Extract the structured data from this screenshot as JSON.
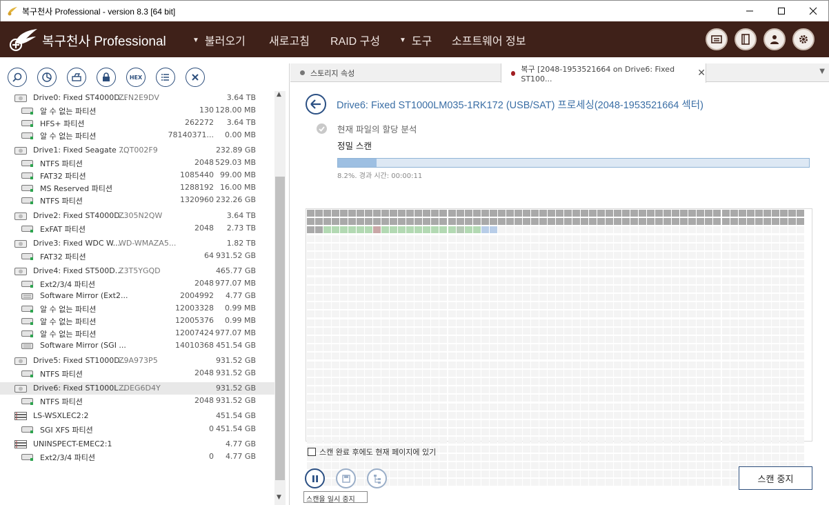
{
  "window": {
    "title": "복구천사 Professional - version 8.3 [64 bit]"
  },
  "header": {
    "brand": "복구천사 Professional",
    "menu": [
      {
        "label": "불러오기",
        "has_caret": true
      },
      {
        "label": "새로고침",
        "has_caret": false
      },
      {
        "label": "RAID 구성",
        "has_caret": false
      },
      {
        "label": "도구",
        "has_caret": true
      },
      {
        "label": "소프트웨어 정보",
        "has_caret": false
      }
    ],
    "icons": [
      "messages-icon",
      "panel-icon",
      "user-icon",
      "settings-icon"
    ]
  },
  "left_toolbar": {
    "icons": [
      "search-icon",
      "scan-icon",
      "open-drive-icon",
      "lock-icon",
      "hex-icon",
      "list-icon",
      "close-icon"
    ],
    "hex_label": "HEX"
  },
  "tree": [
    {
      "type": "drive",
      "name": "Drive0: Fixed ST4000D...",
      "serial": "ZFN2E9DV",
      "start": "",
      "size": "3.64 TB",
      "icon": "hdd-icon"
    },
    {
      "type": "part",
      "name": "알 수 없는 파티션",
      "start": "130",
      "size": "128.00 MB",
      "icon": "partition-icon"
    },
    {
      "type": "part",
      "name": "HFS+ 파티션",
      "start": "262272",
      "size": "3.64 TB",
      "icon": "partition-icon"
    },
    {
      "type": "part",
      "name": "알 수 없는 파티션",
      "start": "78140371...",
      "size": "0.00 MB",
      "icon": "partition-icon"
    },
    {
      "type": "drive",
      "name": "Drive1: Fixed Seagate ...",
      "serial": "7QT002F9",
      "start": "",
      "size": "232.89 GB",
      "icon": "hdd-icon"
    },
    {
      "type": "part",
      "name": "NTFS 파티션",
      "start": "2048",
      "size": "529.03 MB",
      "icon": "partition-icon"
    },
    {
      "type": "part",
      "name": "FAT32 파티션",
      "start": "1085440",
      "size": "99.00 MB",
      "icon": "partition-icon"
    },
    {
      "type": "part",
      "name": "MS Reserved 파티션",
      "start": "1288192",
      "size": "16.00 MB",
      "icon": "partition-icon"
    },
    {
      "type": "part",
      "name": "NTFS 파티션",
      "start": "1320960",
      "size": "232.26 GB",
      "icon": "partition-icon"
    },
    {
      "type": "drive",
      "name": "Drive2: Fixed ST4000D...",
      "serial": "Z305N2QW",
      "start": "",
      "size": "3.64 TB",
      "icon": "hdd-icon"
    },
    {
      "type": "part",
      "name": "ExFAT 파티션",
      "start": "2048",
      "size": "2.73 TB",
      "icon": "partition-icon"
    },
    {
      "type": "drive",
      "name": "Drive3: Fixed WDC W...",
      "serial": "WD-WMAZA5...",
      "start": "",
      "size": "1.82 TB",
      "icon": "hdd-icon"
    },
    {
      "type": "part",
      "name": "FAT32 파티션",
      "start": "64",
      "size": "931.52 GB",
      "icon": "partition-icon"
    },
    {
      "type": "drive",
      "name": "Drive4: Fixed ST500D...",
      "serial": "Z3T5YGQD",
      "start": "",
      "size": "465.77 GB",
      "icon": "hdd-icon"
    },
    {
      "type": "part",
      "name": "Ext2/3/4 파티션",
      "start": "2048",
      "size": "977.07 MB",
      "icon": "partition-icon"
    },
    {
      "type": "part",
      "name": "Software Mirror (Ext2...",
      "start": "2004992",
      "size": "4.77 GB",
      "icon": "raid-partition-icon"
    },
    {
      "type": "part",
      "name": "알 수 없는 파티션",
      "start": "12003328",
      "size": "0.99 MB",
      "icon": "partition-icon"
    },
    {
      "type": "part",
      "name": "알 수 없는 파티션",
      "start": "12005376",
      "size": "0.99 MB",
      "icon": "partition-icon"
    },
    {
      "type": "part",
      "name": "알 수 없는 파티션",
      "start": "12007424",
      "size": "977.07 MB",
      "icon": "partition-icon"
    },
    {
      "type": "part",
      "name": "Software Mirror (SGI ...",
      "start": "14010368",
      "size": "451.54 GB",
      "icon": "raid-partition-icon"
    },
    {
      "type": "drive",
      "name": "Drive5: Fixed ST1000D...",
      "serial": "Z9A973P5",
      "start": "",
      "size": "931.52 GB",
      "icon": "hdd-icon"
    },
    {
      "type": "part",
      "name": "NTFS 파티션",
      "start": "2048",
      "size": "931.52 GB",
      "icon": "partition-icon"
    },
    {
      "type": "drive",
      "name": "Drive6: Fixed ST1000L...",
      "serial": "ZDEG6D4Y",
      "start": "",
      "size": "931.52 GB",
      "icon": "hdd-icon",
      "selected": true
    },
    {
      "type": "part",
      "name": "NTFS 파티션",
      "start": "2048",
      "size": "931.52 GB",
      "icon": "partition-icon"
    },
    {
      "type": "raid",
      "name": "LS-WSXLEC2:2",
      "serial": "",
      "start": "",
      "size": "451.54 GB",
      "icon": "raid-icon"
    },
    {
      "type": "part",
      "name": "SGI XFS 파티션",
      "start": "0",
      "size": "451.54 GB",
      "icon": "partition-icon"
    },
    {
      "type": "raid",
      "name": "UNINSPECT-EMEC2:1",
      "serial": "",
      "start": "",
      "size": "4.77 GB",
      "icon": "raid-icon"
    },
    {
      "type": "part",
      "name": "Ext2/3/4 파티션",
      "start": "0",
      "size": "4.77 GB",
      "icon": "partition-icon"
    }
  ],
  "tabs": [
    {
      "label": "스토리지 속성",
      "dot_color": "#777777",
      "active": false
    },
    {
      "label": "복구 [2048-1953521664 on Drive6: Fixed ST100...",
      "dot_color": "#a11e22",
      "active": true
    }
  ],
  "main": {
    "title": "Drive6: Fixed ST1000LM035-1RK172 (USB/SAT) 프로세싱(2048-1953521664 섹터)",
    "step_done": "현재 파일의 할당 분석",
    "step_current": "정밀 스캔",
    "progress": 0.082,
    "progress_text": "8.2%. 경과 시간: 00:00:11",
    "stay_checkbox_label": "스캔 완료 후에도 현재 페이지에 있기",
    "stay_checked": false,
    "pause_tooltip": "스캔을 일시 중지",
    "stop_label": "스캔 중지"
  },
  "scan_map": {
    "cols": 60,
    "rows": 33,
    "done_rows": 2,
    "third_row": [
      "gray",
      "gray",
      "found",
      "found",
      "found",
      "found",
      "found",
      "found",
      "bad",
      "found",
      "found",
      "found",
      "found",
      "found",
      "found",
      "found",
      "found",
      "found",
      "scan",
      "found",
      "found",
      "info",
      "info"
    ],
    "colors": {
      "gray": "#a9a9a9",
      "found": "#b3d9b3",
      "bad": "#c9a7a7",
      "scan": "#b5c9b5",
      "info": "#b8cde8",
      "empty": "#f4f4f4"
    }
  }
}
